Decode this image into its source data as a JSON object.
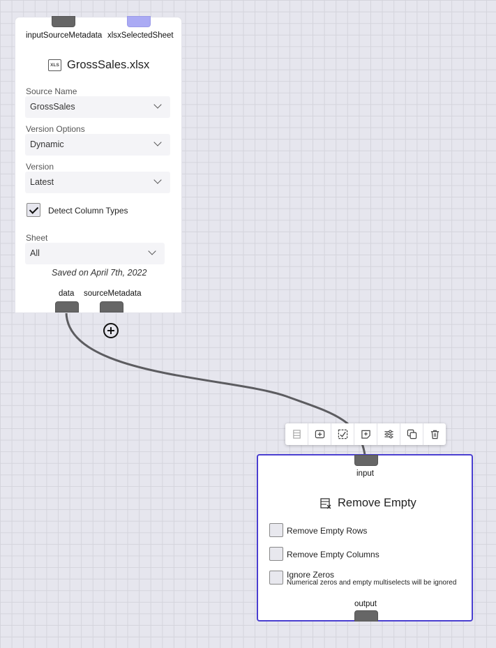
{
  "canvas": {
    "background": "#e6e6ee",
    "grid_color": "#d4d4dc"
  },
  "source_node": {
    "input_ports": [
      "inputSourceMetadata",
      "xlsxSelectedSheet"
    ],
    "title": "GrossSales.xlsx",
    "file_icon_text": "XLS",
    "fields": [
      {
        "label": "Source Name",
        "value": "GrossSales"
      },
      {
        "label": "Version Options",
        "value": "Dynamic"
      },
      {
        "label": "Version",
        "value": "Latest"
      }
    ],
    "detect_column_types": {
      "label": "Detect Column Types",
      "checked": true
    },
    "sheet": {
      "label": "Sheet",
      "value": "All"
    },
    "saved_text": "Saved on April 7th, 2022",
    "output_ports": [
      "data",
      "sourceMetadata"
    ]
  },
  "toolbar": {
    "buttons": [
      "table-remove-icon",
      "add-node-icon",
      "chart-check-icon",
      "add-note-icon",
      "settings-sliders-icon",
      "duplicate-icon",
      "trash-icon"
    ]
  },
  "remove_empty_node": {
    "input_port": "input",
    "title": "Remove Empty",
    "options": [
      {
        "label": "Remove Empty Rows",
        "checked": false
      },
      {
        "label": "Remove Empty Columns",
        "checked": false
      },
      {
        "label": "Ignore Zeros",
        "checked": false,
        "help": "Numerical zeros and empty multiselects will be ignored"
      }
    ],
    "output_port": "output",
    "border_color": "#4a3fd0"
  }
}
